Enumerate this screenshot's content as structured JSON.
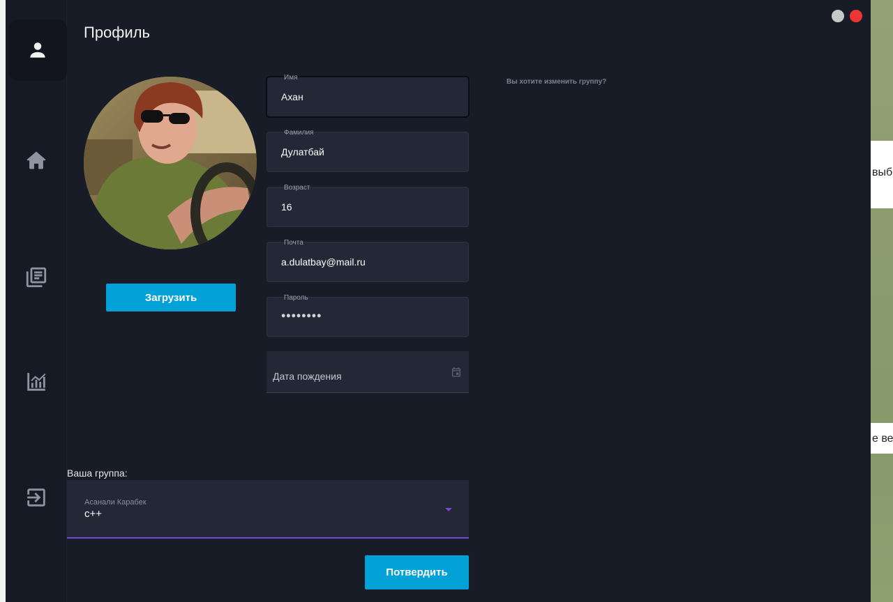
{
  "window": {
    "title": "Профиль"
  },
  "sidebar": {
    "items": [
      {
        "name": "profile",
        "icon": "user-icon"
      },
      {
        "name": "home",
        "icon": "home-icon"
      },
      {
        "name": "library",
        "icon": "library-icon"
      },
      {
        "name": "stats",
        "icon": "chart-icon"
      },
      {
        "name": "logout",
        "icon": "logout-icon"
      }
    ]
  },
  "profile": {
    "upload_label": "Загрузить",
    "fields": {
      "first_name": {
        "label": "Имя",
        "value": "Ахан"
      },
      "last_name": {
        "label": "Фамилия",
        "value": "Дулатбай"
      },
      "age": {
        "label": "Возраст",
        "value": "16"
      },
      "email": {
        "label": "Почта",
        "value": "a.dulatbay@mail.ru"
      },
      "password": {
        "label": "Пароль",
        "value": "••••••••"
      }
    },
    "birth_date": {
      "placeholder": "Дата пождения"
    },
    "change_group_prompt": "Вы хотите изменить группу?",
    "group": {
      "label": "Ваша группа:",
      "teacher": "Асанали Карабек",
      "value": "c++"
    },
    "confirm_label": "Потвердить"
  },
  "background": {
    "card1_text": "выб",
    "card2_text": "е вес"
  },
  "colors": {
    "accent": "#02a2d9",
    "select_underline": "#7b45d4",
    "close": "#ee3535"
  }
}
